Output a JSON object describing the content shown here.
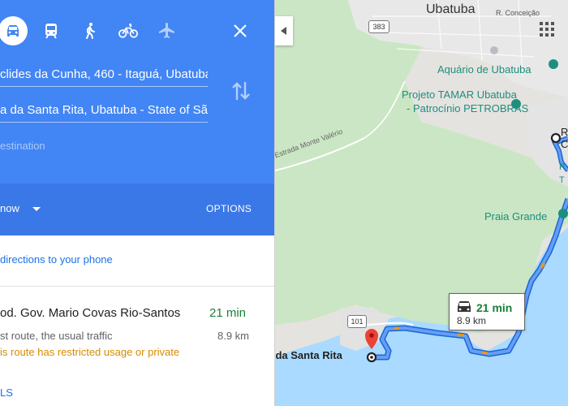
{
  "colors": {
    "header_blue": "#4285f4",
    "route_blue": "#4285f4",
    "time_green": "#188038",
    "warning_orange": "#d68b00",
    "link_blue": "#1a73e8"
  },
  "travel_modes": [
    {
      "name": "drive",
      "icon": "car-icon",
      "selected": true
    },
    {
      "name": "transit",
      "icon": "transit-icon",
      "selected": false
    },
    {
      "name": "walk",
      "icon": "walk-icon",
      "selected": false
    },
    {
      "name": "bike",
      "icon": "bike-icon",
      "selected": false
    },
    {
      "name": "flight",
      "icon": "plane-icon",
      "selected": false
    }
  ],
  "directions": {
    "origin": "clides da Cunha, 460 - Itaguá, Ubatuba",
    "destination": "a da Santa Rita, Ubatuba - State of São Paulo",
    "add_destination": "estination",
    "depart_label": "now",
    "options_label": "OPTIONS"
  },
  "send_link": "directions to your phone",
  "route": {
    "name": "od. Gov. Mario Covas Rio-Santos",
    "time": "21 min",
    "note": "st route, the usual traffic",
    "distance": "8.9 km",
    "warning": "is route has restricted usage or private",
    "details_label": "LS"
  },
  "map": {
    "labels": {
      "city": "Ubatuba",
      "conceicao": "R. Conceição",
      "aquario": "Aquário de Ubatuba",
      "tamar_line1": "Projeto TAMAR Ubatuba",
      "tamar_line2": "- Patrocínio PETROBRAS",
      "estrada": "Estrada Monte Valério",
      "praia_grande": "Praia Grande",
      "santa_rita": "ia da Santa Rita",
      "edge_p": "P",
      "edge_t": "T",
      "edge_r": "R",
      "edge_c": "C",
      "highway_383": "383",
      "highway_101": "101"
    },
    "bubble": {
      "time": "21 min",
      "distance": "8.9 km"
    }
  }
}
